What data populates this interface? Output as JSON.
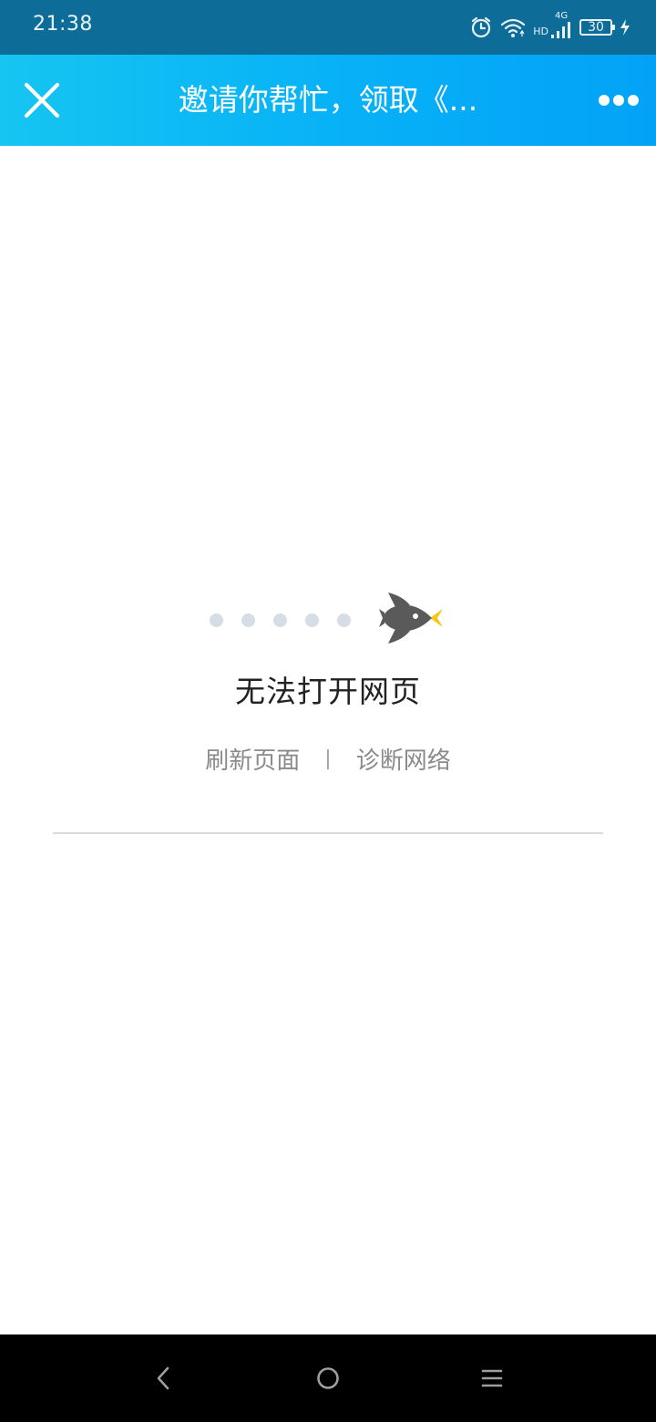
{
  "status_bar": {
    "time": "21:38",
    "network_type": "4G",
    "hd_label": "HD",
    "battery_level": "30",
    "icons": [
      "alarm-icon",
      "wifi-icon",
      "signal-icon",
      "battery-icon",
      "charging-icon"
    ]
  },
  "header": {
    "title": "邀请你帮忙，领取《...",
    "close_icon": "close-icon",
    "more_icon": "more-icon"
  },
  "error": {
    "illustration_icon": "rocket-icon",
    "progress_dots": 5,
    "title": "无法打开网页",
    "refresh_label": "刷新页面",
    "separator": "|",
    "diagnose_label": "诊断网络"
  },
  "nav_bar": {
    "icons": [
      "back-icon",
      "home-icon",
      "recent-apps-icon"
    ]
  },
  "colors": {
    "status_bar_bg": "#0e6d98",
    "header_gradient_start": "#16c5f1",
    "header_gradient_end": "#03a2f7",
    "rocket_body": "#5a5a5a",
    "rocket_flame": "#f5c518",
    "dot": "#d6dde4"
  }
}
